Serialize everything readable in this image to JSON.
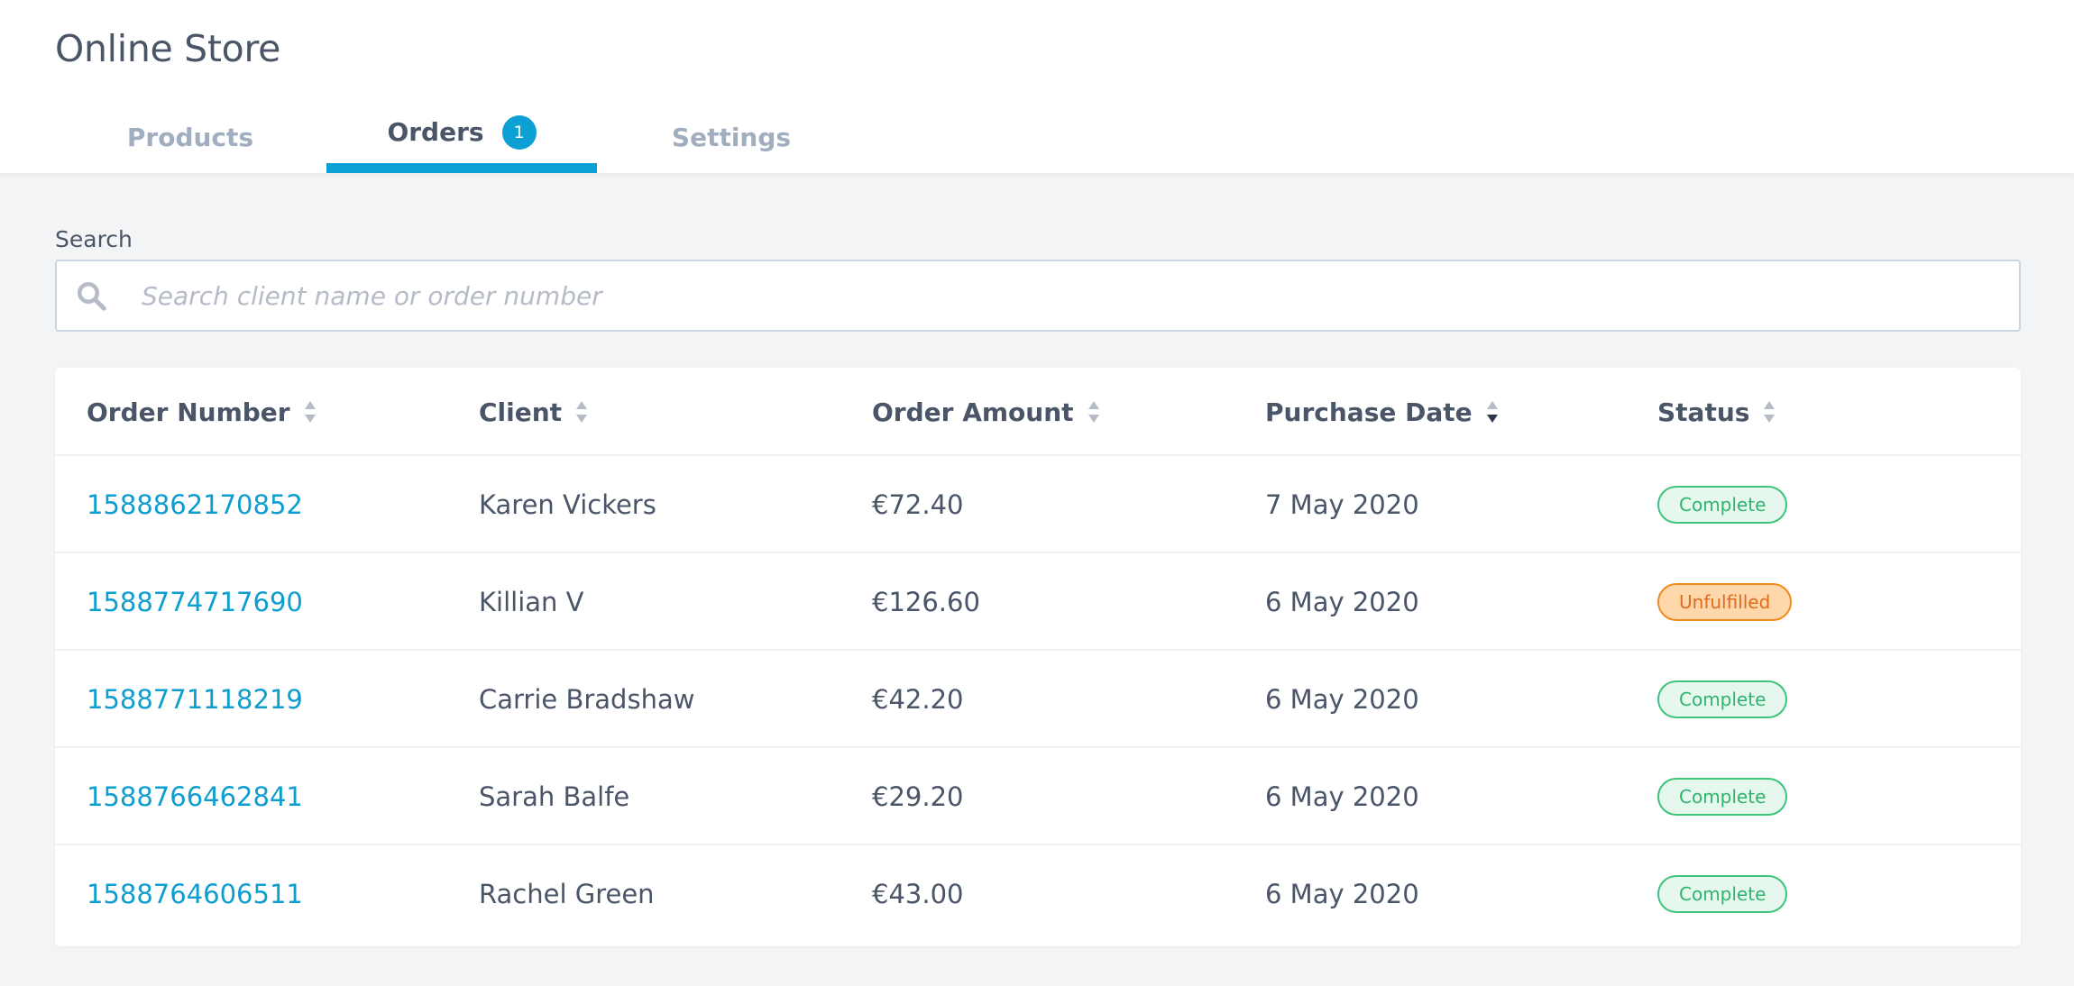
{
  "app": {
    "title": "Online Store"
  },
  "tabs": [
    {
      "label": "Products",
      "active": false
    },
    {
      "label": "Orders",
      "active": true,
      "badge": "1"
    },
    {
      "label": "Settings",
      "active": false
    }
  ],
  "search": {
    "label": "Search",
    "placeholder": "Search client name or order number",
    "value": "",
    "icon": "search-icon"
  },
  "table": {
    "columns": [
      "Order Number",
      "Client",
      "Order Amount",
      "Purchase Date",
      "Status"
    ],
    "sorted_column": "Purchase Date",
    "sort_direction": "descending",
    "rows": [
      {
        "order_number": "1588862170852",
        "client": "Karen Vickers",
        "amount": "€72.40",
        "date": "7 May 2020",
        "status": "Complete"
      },
      {
        "order_number": "1588774717690",
        "client": "Killian V",
        "amount": "€126.60",
        "date": "6 May 2020",
        "status": "Unfulfilled"
      },
      {
        "order_number": "1588771118219",
        "client": "Carrie Bradshaw",
        "amount": "€42.20",
        "date": "6 May 2020",
        "status": "Complete"
      },
      {
        "order_number": "1588766462841",
        "client": "Sarah Balfe",
        "amount": "€29.20",
        "date": "6 May 2020",
        "status": "Complete"
      },
      {
        "order_number": "1588764606511",
        "client": "Rachel Green",
        "amount": "€43.00",
        "date": "6 May 2020",
        "status": "Complete"
      }
    ]
  },
  "colors": {
    "accent": "#0da0d4",
    "link": "#0d9ecf",
    "complete": "#3cc47c",
    "unfulfilled": "#f38a1d"
  }
}
